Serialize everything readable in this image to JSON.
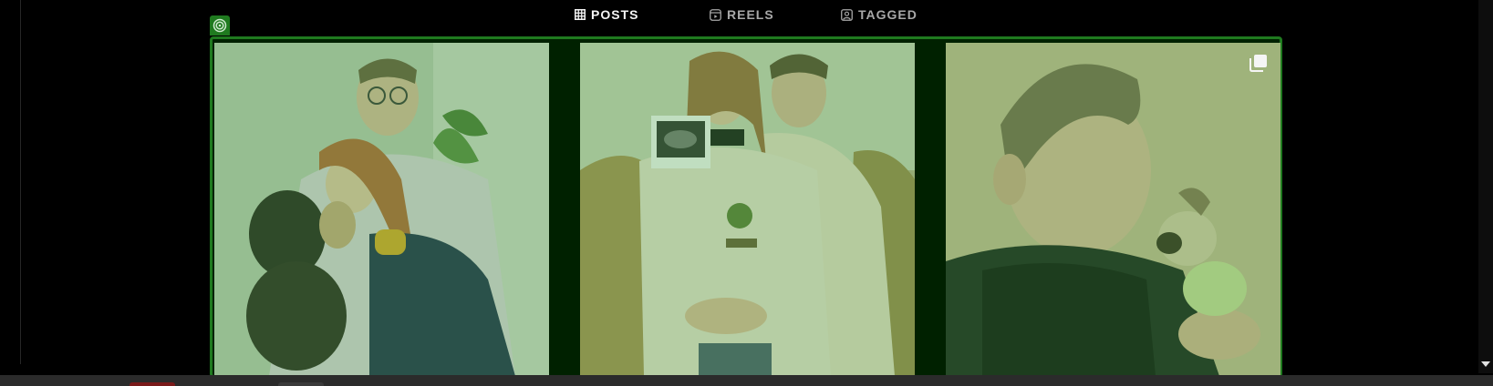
{
  "tabs": [
    {
      "label": "POSTS",
      "icon": "grid-icon",
      "active": true
    },
    {
      "label": "REELS",
      "icon": "reels-icon",
      "active": false
    },
    {
      "label": "TAGGED",
      "icon": "tagged-icon",
      "active": false
    }
  ],
  "overlay": {
    "color": "#1f7a1f",
    "badge_icon": "target-icon"
  },
  "posts": [
    {
      "description_icon": "photo",
      "multi": false
    },
    {
      "description_icon": "photo",
      "multi": false
    },
    {
      "description_icon": "photo",
      "multi": true
    }
  ],
  "colors": {
    "background": "#000000",
    "tab_active": "#f5f5f5",
    "tab_inactive": "#a8a8a8"
  }
}
